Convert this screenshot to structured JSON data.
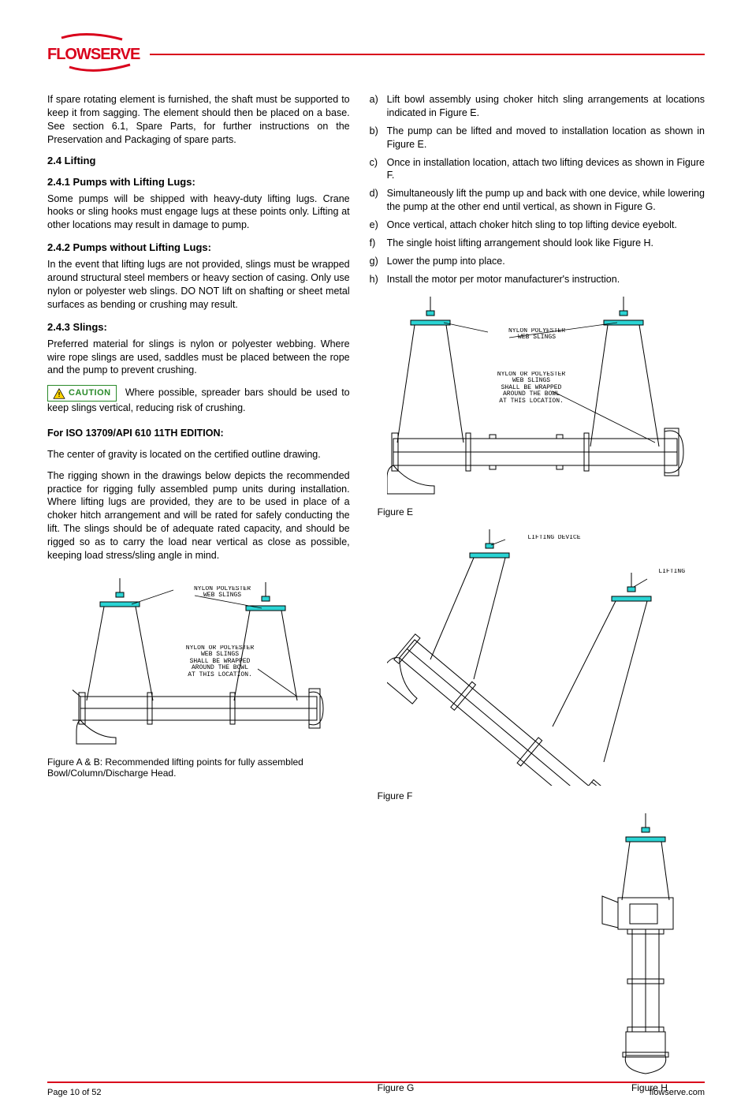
{
  "logo_text": "FLOWSERVE",
  "left": {
    "p1": "If spare rotating element is furnished, the shaft must be supported to keep it from sagging. The element should then be placed on a base. See section 6.1, Spare Parts, for further instructions on the Preservation and Packaging of spare parts.",
    "sec_24": "2.4 Lifting",
    "sec_241": "2.4.1 Pumps with Lifting Lugs:",
    "p241": "Some pumps will be shipped with heavy-duty lifting lugs. Crane hooks or sling hooks must engage lugs at these points only. Lifting at other locations may result in damage to pump.",
    "sec_242": "2.4.2 Pumps without Lifting Lugs:",
    "p242": "In the event that lifting lugs are not provided, slings must be wrapped around structural steel members or heavy section of casing. Only use nylon or polyester web slings. DO NOT lift on shafting or sheet metal surfaces as bending or crushing may result.",
    "sec_243": "2.4.3 Slings:",
    "p243": "Preferred material for slings is nylon or polyester webbing. Where wire rope slings are used, saddles must be placed between the rope and the pump to prevent crushing.",
    "caution_label": "CAUTION",
    "caution_text": "Where possible, spreader bars should be used to keep slings vertical, reducing risk of crushing.",
    "p_610_head": "For ISO 13709/API 610 11TH EDITION:",
    "p_610_a": "The center of gravity is located on the certified outline drawing.",
    "p_610_b": "The rigging shown in the drawings below depicts the recommended practice for rigging fully assembled pump units during installation. Where lifting lugs are provided, they are to be used in place of a choker hitch arrangement and will be rated for safely conducting the lift. The slings should be of adequate rated capacity, and should be rigged so as to carry the load near vertical as close as possible, keeping load stress/sling angle in mind.",
    "fig_ab_caption": "Figure A & B: Recommended lifting points for fully assembled Bowl/Column/Discharge Head."
  },
  "right": {
    "items_ef": [
      "Lift bowl assembly using choker hitch sling arrangements at locations indicated in Figure E.",
      "The pump can be lifted and moved to installation location as shown in Figure E.",
      "Once in installation location, attach two lifting devices as shown in Figure F.",
      "Simultaneously lift the pump up and back with one device, while lowering the pump at the other end until vertical, as shown in Figure G.",
      "Once vertical, attach choker hitch sling to top lifting device eyebolt.",
      "The single hoist lifting arrangement should look like Figure H.",
      "Lower the pump into place.",
      "Install the motor per motor manufacturer's instruction."
    ],
    "item_markers": [
      "a)",
      "b)",
      "c)",
      "d)",
      "e)",
      "f)",
      "g)",
      "h)"
    ],
    "figE_caption": "Figure E",
    "figF_caption": "Figure F",
    "figG_caption": "Figure G",
    "figH_caption": "Figure H"
  },
  "diagram_labels": {
    "nylon_header": "NYLON POLYESTER\nWEB SLINGS",
    "nylon_note": "NYLON OR POLYESTER\nWEB SLINGS\nSHALL BE WRAPPED\nAROUND THE BOWL\nAT THIS LOCATION.",
    "lifting_device": "LIFTING DEVICE"
  },
  "footer": {
    "left": "Page 10 of 52",
    "right": "flowserve.com"
  }
}
